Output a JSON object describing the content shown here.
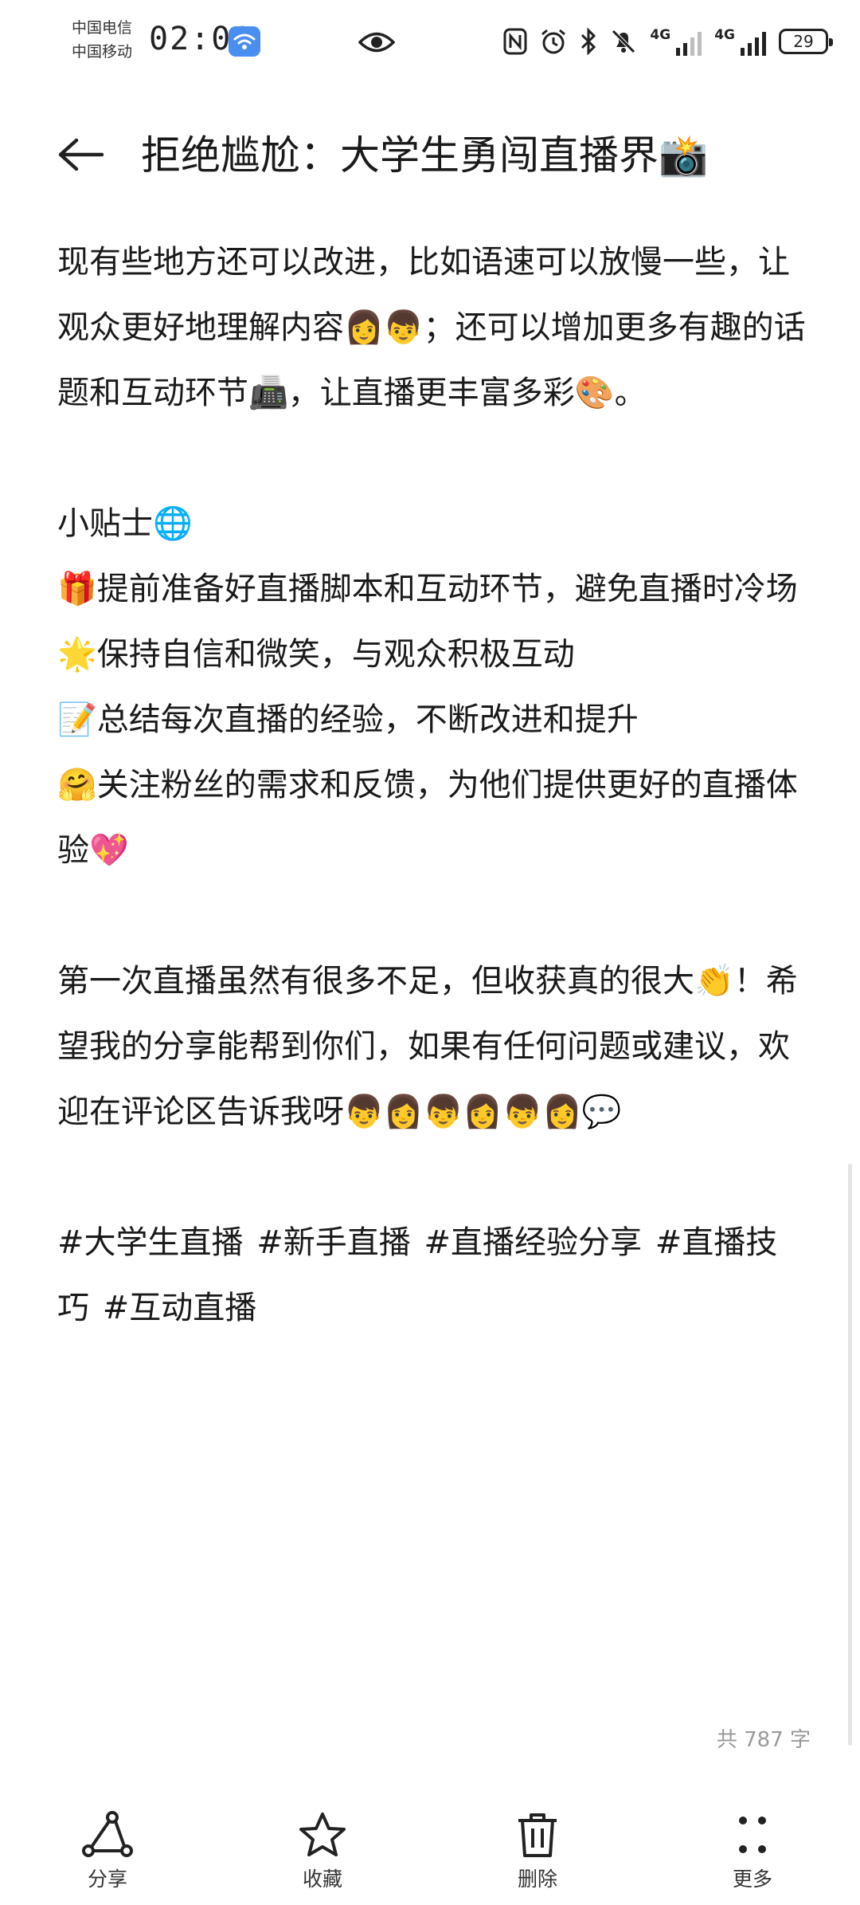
{
  "status_bar": {
    "carrier_1": "中国电信",
    "carrier_2": "中国移动",
    "time": "02:01",
    "network_1": "4G",
    "network_2": "4G",
    "battery": "29",
    "icons": [
      "wifi-icon",
      "eye-icon",
      "nfc-icon",
      "alarm-icon",
      "bluetooth-icon",
      "mute-icon",
      "signal-icon",
      "battery-icon"
    ]
  },
  "header": {
    "back_icon": "arrow-left-icon",
    "title": "拒绝尴尬：大学生勇闯直播界📸"
  },
  "content": {
    "paragraph_1": "现有些地方还可以改进，比如语速可以放慢一些，让观众更好地理解内容👩👦；还可以增加更多有趣的话题和互动环节📠，让直播更丰富多彩🎨。",
    "tips_title": "小贴士🌐",
    "tip_1": "🎁提前准备好直播脚本和互动环节，避免直播时冷场",
    "tip_2": "🌟保持自信和微笑，与观众积极互动",
    "tip_3": "📝总结每次直播的经验，不断改进和提升",
    "tip_4": "🤗关注粉丝的需求和反馈，为他们提供更好的直播体验💖",
    "paragraph_2": "第一次直播虽然有很多不足，但收获真的很大👏！希望我的分享能帮到你们，如果有任何问题或建议，欢迎在评论区告诉我呀👦👩👦👩👦👩💬",
    "hashtags": "#大学生直播 #新手直播 #直播经验分享 #直播技巧 #互动直播"
  },
  "word_count": "共 787 字",
  "toolbar": {
    "share_label": "分享",
    "favorite_label": "收藏",
    "delete_label": "删除",
    "more_label": "更多",
    "icons": [
      "share-icon",
      "star-icon",
      "trash-icon",
      "more-icon"
    ]
  },
  "colors": {
    "background": "#ffffff",
    "text": "#1a1a1a",
    "muted": "#9a9a9a",
    "wifi_badge": "#4a8ef0"
  }
}
